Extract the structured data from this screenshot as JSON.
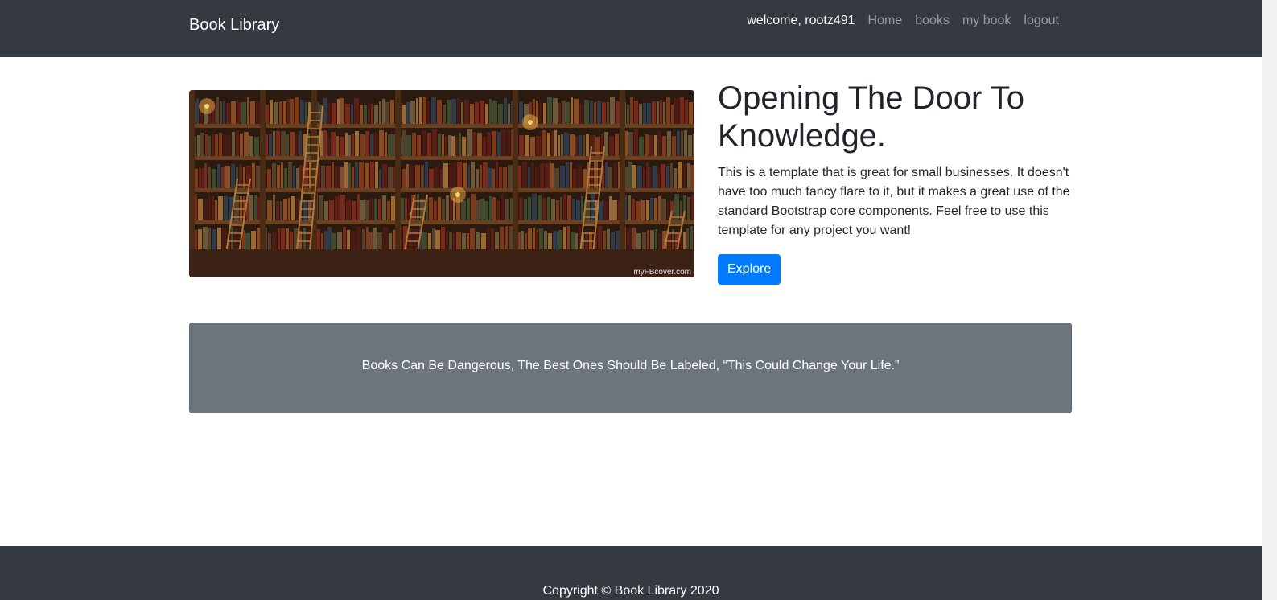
{
  "navbar": {
    "brand": "Book Library",
    "welcome": "welcome, rootz491",
    "links": [
      "Home",
      "books",
      "my book",
      "logout"
    ]
  },
  "hero": {
    "title": "Opening The Door To Knowledge.",
    "text": "This is a template that is great for small businesses. It doesn't have too much fancy flare to it, but it makes a great use of the standard Bootstrap core components. Feel free to use this template for any project you want!",
    "button_label": "Explore",
    "image_watermark": "myFBcover.com"
  },
  "quote": {
    "text": "Books Can Be Dangerous, The Best Ones Should Be Labeled, “This Could Change Your Life.”"
  },
  "footer": {
    "text": "Copyright © Book Library 2020"
  },
  "colors": {
    "navbar": "#343a40",
    "primary": "#007bff",
    "card": "#6c757d"
  }
}
